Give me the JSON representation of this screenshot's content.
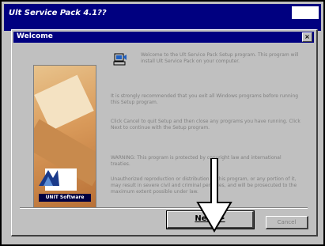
{
  "outer_window": {
    "title": "Ult Service Pack 4.1??"
  },
  "dialog": {
    "title": "Welcome",
    "close_label": "×",
    "intro_text": "Welcome to the Ult Service Pack Setup program. This program will install Ult Service Pack on your computer.",
    "paragraph_1": "It is strongly recommended that you exit all Windows programs before running this Setup program.",
    "paragraph_2": "Click Cancel to quit Setup and then close any programs you have running. Click Next to continue with the Setup program.",
    "warning_1": "WARNING: This program is protected by copyright law and international treaties.",
    "warning_2": "Unauthorized reproduction or distribution of this program, or any portion of it, may result in severe civil and criminal penalties, and will be prosecuted to the maximum extent possible under law.",
    "logo_text": "UNIT Software"
  },
  "buttons": {
    "next_label": "Next >",
    "cancel_label": "Cancel"
  },
  "colors": {
    "titlebar": "#000080",
    "face": "#c0c0c0"
  }
}
